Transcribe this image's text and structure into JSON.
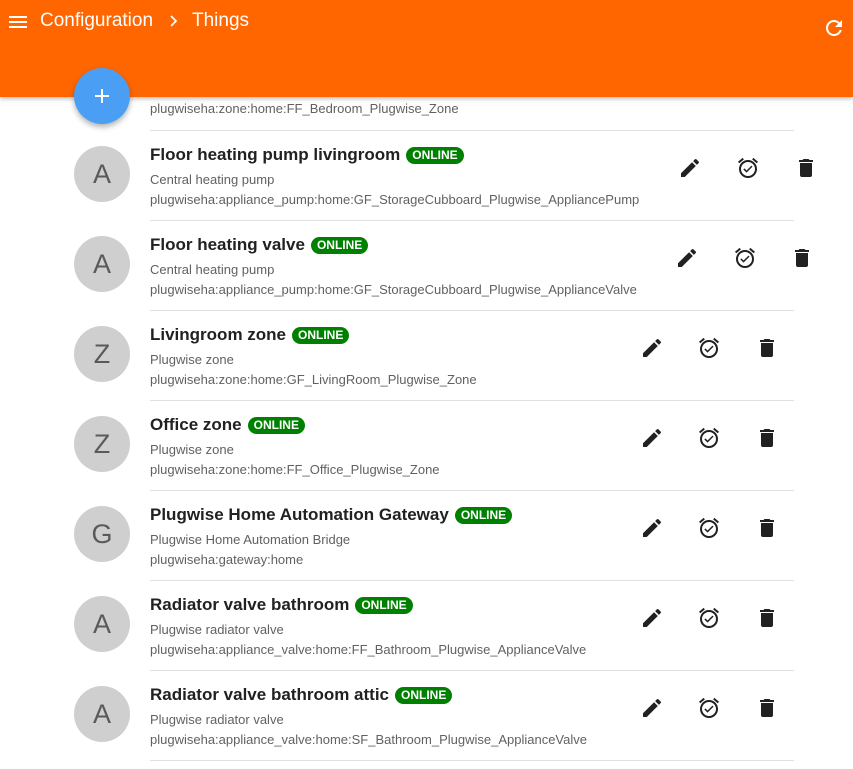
{
  "header": {
    "breadcrumb": [
      "Configuration",
      "Things"
    ],
    "background_color": "#ff6600"
  },
  "icons": {
    "menu": "menu-icon",
    "breadcrumb_separator": "chevron-right-icon",
    "refresh": "refresh-icon",
    "add": "plus-icon",
    "edit": "pencil-icon",
    "schedule": "alarm-clock-icon",
    "delete": "trash-icon"
  },
  "partial_row": {
    "uid": "plugwiseha:zone:home:FF_Bedroom_Plugwise_Zone"
  },
  "status_color": "#008000",
  "things": [
    {
      "avatar": "A",
      "name": "Floor heating pump livingroom",
      "status": "ONLINE",
      "type": "Central heating pump",
      "uid": "plugwiseha:appliance_pump:home:GF_StorageCubboard_Plugwise_AppliancePump"
    },
    {
      "avatar": "A",
      "name": "Floor heating valve",
      "status": "ONLINE",
      "type": "Central heating pump",
      "uid": "plugwiseha:appliance_pump:home:GF_StorageCubboard_Plugwise_ApplianceValve"
    },
    {
      "avatar": "Z",
      "name": "Livingroom zone",
      "status": "ONLINE",
      "type": "Plugwise zone",
      "uid": "plugwiseha:zone:home:GF_LivingRoom_Plugwise_Zone"
    },
    {
      "avatar": "Z",
      "name": "Office zone",
      "status": "ONLINE",
      "type": "Plugwise zone",
      "uid": "plugwiseha:zone:home:FF_Office_Plugwise_Zone"
    },
    {
      "avatar": "G",
      "name": "Plugwise Home Automation Gateway",
      "status": "ONLINE",
      "type": "Plugwise Home Automation Bridge",
      "uid": "plugwiseha:gateway:home"
    },
    {
      "avatar": "A",
      "name": "Radiator valve bathroom",
      "status": "ONLINE",
      "type": "Plugwise radiator valve",
      "uid": "plugwiseha:appliance_valve:home:FF_Bathroom_Plugwise_ApplianceValve"
    },
    {
      "avatar": "A",
      "name": "Radiator valve bathroom attic",
      "status": "ONLINE",
      "type": "Plugwise radiator valve",
      "uid": "plugwiseha:appliance_valve:home:SF_Bathroom_Plugwise_ApplianceValve"
    }
  ]
}
